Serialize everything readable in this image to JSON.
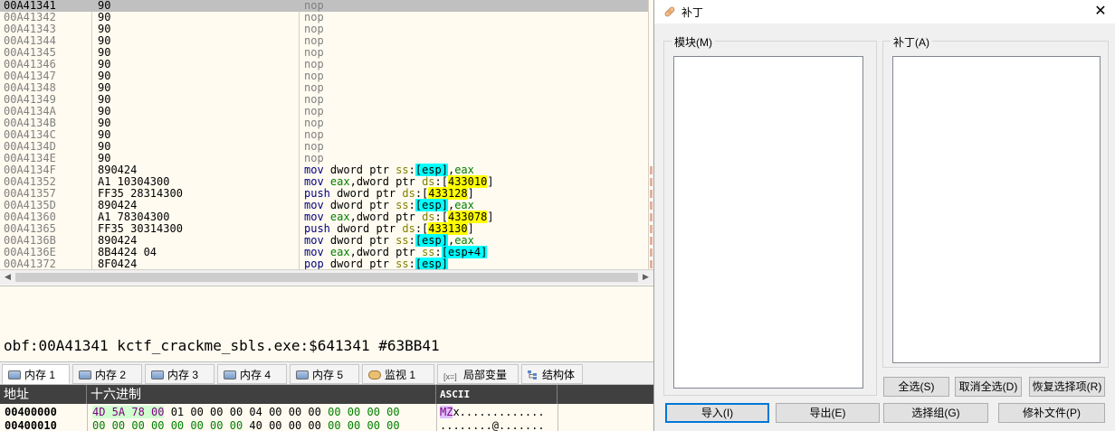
{
  "disasm": {
    "rows": [
      {
        "addr": "00A41341",
        "hex": "90",
        "ins": [
          {
            "t": "nop",
            "c": "nop"
          }
        ],
        "selected": true
      },
      {
        "addr": "00A41342",
        "hex": "90",
        "ins": [
          {
            "t": "nop",
            "c": "nop"
          }
        ]
      },
      {
        "addr": "00A41343",
        "hex": "90",
        "ins": [
          {
            "t": "nop",
            "c": "nop"
          }
        ]
      },
      {
        "addr": "00A41344",
        "hex": "90",
        "ins": [
          {
            "t": "nop",
            "c": "nop"
          }
        ]
      },
      {
        "addr": "00A41345",
        "hex": "90",
        "ins": [
          {
            "t": "nop",
            "c": "nop"
          }
        ]
      },
      {
        "addr": "00A41346",
        "hex": "90",
        "ins": [
          {
            "t": "nop",
            "c": "nop"
          }
        ]
      },
      {
        "addr": "00A41347",
        "hex": "90",
        "ins": [
          {
            "t": "nop",
            "c": "nop"
          }
        ]
      },
      {
        "addr": "00A41348",
        "hex": "90",
        "ins": [
          {
            "t": "nop",
            "c": "nop"
          }
        ]
      },
      {
        "addr": "00A41349",
        "hex": "90",
        "ins": [
          {
            "t": "nop",
            "c": "nop"
          }
        ]
      },
      {
        "addr": "00A4134A",
        "hex": "90",
        "ins": [
          {
            "t": "nop",
            "c": "nop"
          }
        ]
      },
      {
        "addr": "00A4134B",
        "hex": "90",
        "ins": [
          {
            "t": "nop",
            "c": "nop"
          }
        ]
      },
      {
        "addr": "00A4134C",
        "hex": "90",
        "ins": [
          {
            "t": "nop",
            "c": "nop"
          }
        ]
      },
      {
        "addr": "00A4134D",
        "hex": "90",
        "ins": [
          {
            "t": "nop",
            "c": "nop"
          }
        ]
      },
      {
        "addr": "00A4134E",
        "hex": "90",
        "ins": [
          {
            "t": "nop",
            "c": "nop"
          }
        ]
      },
      {
        "addr": "00A4134F",
        "hex": "890424",
        "mark": true,
        "ins": [
          {
            "t": "mov ",
            "c": "kw"
          },
          {
            "t": "dword ptr ",
            "c": "tok-ptr"
          },
          {
            "t": "ss",
            "c": "seg"
          },
          {
            "t": ":",
            "c": "tok-ptr"
          },
          {
            "t": "[esp]",
            "c": "hl-c"
          },
          {
            "t": ",",
            "c": "tok-ptr"
          },
          {
            "t": "eax",
            "c": "reg"
          }
        ]
      },
      {
        "addr": "00A41352",
        "hex": "A1 10304300",
        "mark": true,
        "ins": [
          {
            "t": "mov ",
            "c": "kw"
          },
          {
            "t": "eax",
            "c": "reg"
          },
          {
            "t": ",dword ptr ",
            "c": "tok-ptr"
          },
          {
            "t": "ds",
            "c": "seg"
          },
          {
            "t": ":[",
            "c": "tok-ptr"
          },
          {
            "t": "433010",
            "c": "hl-y"
          },
          {
            "t": "]",
            "c": "tok-ptr"
          }
        ]
      },
      {
        "addr": "00A41357",
        "hex": "FF35 28314300",
        "mark": true,
        "ins": [
          {
            "t": "push ",
            "c": "mn-push"
          },
          {
            "t": "dword ptr ",
            "c": "tok-ptr"
          },
          {
            "t": "ds",
            "c": "seg"
          },
          {
            "t": ":[",
            "c": "tok-ptr"
          },
          {
            "t": "433128",
            "c": "hl-y"
          },
          {
            "t": "]",
            "c": "tok-ptr"
          }
        ]
      },
      {
        "addr": "00A4135D",
        "hex": "890424",
        "mark": true,
        "ins": [
          {
            "t": "mov ",
            "c": "kw"
          },
          {
            "t": "dword ptr ",
            "c": "tok-ptr"
          },
          {
            "t": "ss",
            "c": "seg"
          },
          {
            "t": ":",
            "c": "tok-ptr"
          },
          {
            "t": "[esp]",
            "c": "hl-c"
          },
          {
            "t": ",",
            "c": "tok-ptr"
          },
          {
            "t": "eax",
            "c": "reg"
          }
        ]
      },
      {
        "addr": "00A41360",
        "hex": "A1 78304300",
        "mark": true,
        "ins": [
          {
            "t": "mov ",
            "c": "kw"
          },
          {
            "t": "eax",
            "c": "reg"
          },
          {
            "t": ",dword ptr ",
            "c": "tok-ptr"
          },
          {
            "t": "ds",
            "c": "seg"
          },
          {
            "t": ":[",
            "c": "tok-ptr"
          },
          {
            "t": "433078",
            "c": "hl-y"
          },
          {
            "t": "]",
            "c": "tok-ptr"
          }
        ]
      },
      {
        "addr": "00A41365",
        "hex": "FF35 30314300",
        "mark": true,
        "ins": [
          {
            "t": "push ",
            "c": "mn-push"
          },
          {
            "t": "dword ptr ",
            "c": "tok-ptr"
          },
          {
            "t": "ds",
            "c": "seg"
          },
          {
            "t": ":[",
            "c": "tok-ptr"
          },
          {
            "t": "433130",
            "c": "hl-y"
          },
          {
            "t": "]",
            "c": "tok-ptr"
          }
        ]
      },
      {
        "addr": "00A4136B",
        "hex": "890424",
        "mark": true,
        "ins": [
          {
            "t": "mov ",
            "c": "kw"
          },
          {
            "t": "dword ptr ",
            "c": "tok-ptr"
          },
          {
            "t": "ss",
            "c": "seg"
          },
          {
            "t": ":",
            "c": "tok-ptr"
          },
          {
            "t": "[esp]",
            "c": "hl-c"
          },
          {
            "t": ",",
            "c": "tok-ptr"
          },
          {
            "t": "eax",
            "c": "reg"
          }
        ]
      },
      {
        "addr": "00A4136E",
        "hex": "8B4424 04",
        "mark": true,
        "ins": [
          {
            "t": "mov ",
            "c": "kw"
          },
          {
            "t": "eax",
            "c": "reg"
          },
          {
            "t": ",dword ptr ",
            "c": "tok-ptr"
          },
          {
            "t": "ss",
            "c": "seg"
          },
          {
            "t": ":",
            "c": "tok-ptr"
          },
          {
            "t": "[esp+4]",
            "c": "hl-c"
          }
        ]
      },
      {
        "addr": "00A41372",
        "hex": "8F0424",
        "mark": true,
        "ins": [
          {
            "t": "pop ",
            "c": "mn-pop"
          },
          {
            "t": "dword ptr ",
            "c": "tok-ptr"
          },
          {
            "t": "ss",
            "c": "seg"
          },
          {
            "t": ":",
            "c": "tok-ptr"
          },
          {
            "t": "[esp]",
            "c": "hl-c"
          }
        ]
      }
    ]
  },
  "info_line": "obf:00A41341 kctf_crackme_sbls.exe:$641341 #63BB41",
  "tabs": [
    {
      "label": "内存 1",
      "icon": "memory-icon",
      "active": true
    },
    {
      "label": "内存 2",
      "icon": "memory-icon"
    },
    {
      "label": "内存 3",
      "icon": "memory-icon"
    },
    {
      "label": "内存 4",
      "icon": "memory-icon"
    },
    {
      "label": "内存 5",
      "icon": "memory-icon"
    },
    {
      "label": "监视 1",
      "icon": "watch-icon"
    },
    {
      "label": "局部变量",
      "icon": "locals-icon",
      "icon_text": "[x=]"
    },
    {
      "label": "结构体",
      "icon": "struct-icon"
    }
  ],
  "dump": {
    "headers": {
      "address": "地址",
      "hex": "十六进制",
      "ascii": "ASCII"
    },
    "rows": [
      {
        "addr": "00400000",
        "bytes": [
          {
            "t": "4D 5A 78 00",
            "c": "b-purple"
          },
          {
            "t": " 01 00 00 00",
            "c": "b-black"
          },
          {
            "t": " 04 00 00 00",
            "c": "b-black"
          },
          {
            "t": " 00 00 00 00",
            "c": "b-green"
          }
        ],
        "ascii": [
          {
            "t": "MZ",
            "c": "a-purple"
          },
          {
            "t": "x.............",
            "c": "b-black"
          }
        ]
      },
      {
        "addr": "00400010",
        "bytes": [
          {
            "t": "00 00 00 00",
            "c": "b-green"
          },
          {
            "t": " 00 00 00 00",
            "c": "b-green"
          },
          {
            "t": " 40 00 00 00",
            "c": "b-black"
          },
          {
            "t": " 00 00 00 00",
            "c": "b-green"
          }
        ],
        "ascii": [
          {
            "t": "........@.......",
            "c": "b-black"
          }
        ]
      }
    ]
  },
  "patch_dialog": {
    "title": "补丁",
    "close": "✕",
    "modules_label": "模块(M)",
    "patches_label": "补丁(A)",
    "btn_select_all": "全选(S)",
    "btn_deselect_all": "取消全选(D)",
    "btn_restore": "恢复选择项(R)",
    "btn_import": "导入(I)",
    "btn_export": "导出(E)",
    "btn_select_group": "选择组(G)",
    "btn_patch_file": "修补文件(P)"
  }
}
